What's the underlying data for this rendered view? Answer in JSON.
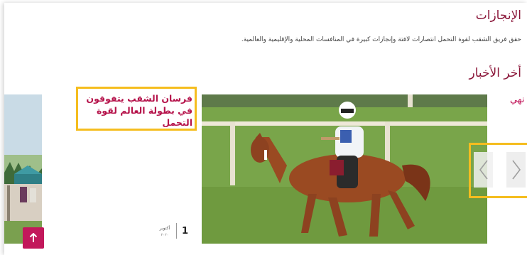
{
  "achievements": {
    "title": "الإنجازات",
    "description": "حقق فريق الشقب لقوة التحمل انتصارات لافتة وإنجازات كبيرة في المنافسات المحلية والإقليمية والعالمية."
  },
  "news": {
    "title": "أخر الأخبار",
    "partial_next_headline": "نهي",
    "current": {
      "headline": "فرسان الشقب يتفوقون في بطولة العالم لقوة التحمل",
      "day": "1",
      "month": "أكتوبر",
      "year": "٢٠٢٠"
    }
  },
  "icons": {
    "scroll_top": "arrow-up-icon",
    "prev": "chevron-left-icon",
    "next": "chevron-right-icon"
  },
  "colors": {
    "brand": "#8a1538",
    "accent": "#c2185b",
    "highlight": "#f5bd1f"
  }
}
